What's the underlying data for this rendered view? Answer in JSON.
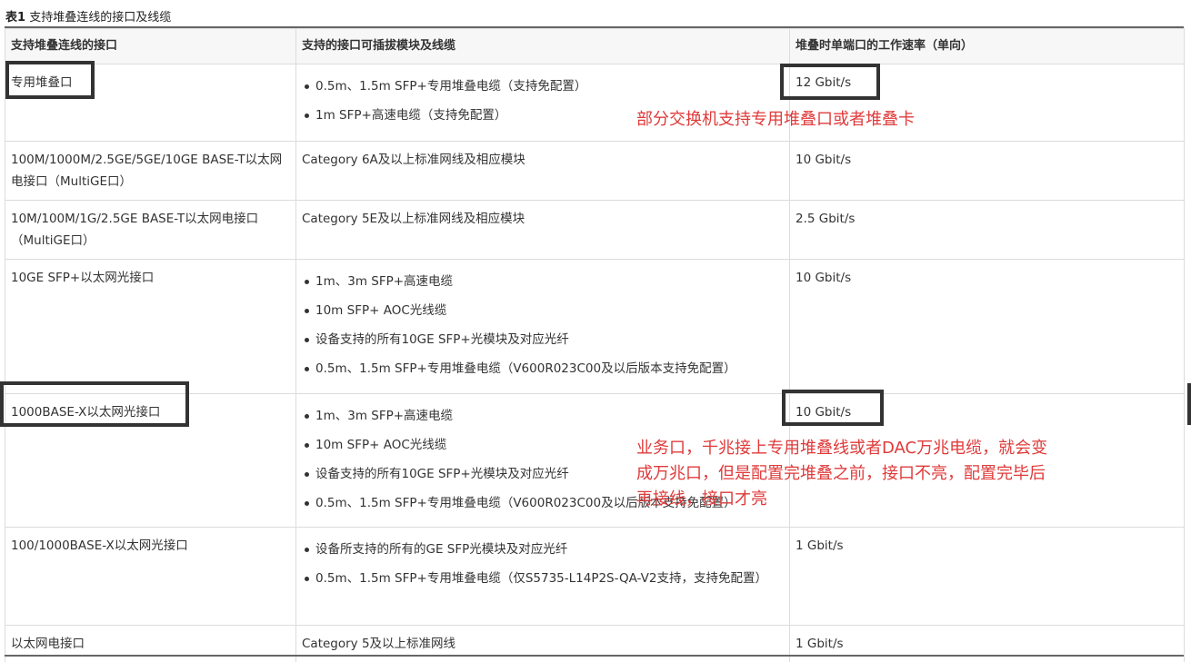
{
  "caption": {
    "label": "表1",
    "text": "支持堆叠连线的接口及线缆"
  },
  "table": {
    "headers": [
      "支持堆叠连线的接口",
      "支持的接口可插拔模块及线缆",
      "堆叠时单端口的工作速率（单向）"
    ],
    "rows": [
      {
        "interface": "专用堆叠口",
        "items": [
          "0.5m、1.5m SFP+专用堆叠电缆（支持免配置）",
          "1m SFP+高速电缆（支持免配置）"
        ],
        "speed": "12 Gbit/s"
      },
      {
        "interface": "100M/1000M/2.5GE/5GE/10GE BASE-T以太网电接口（MultiGE口）",
        "text": "Category 6A及以上标准网线及相应模块",
        "speed": "10 Gbit/s"
      },
      {
        "interface": "10M/100M/1G/2.5GE BASE-T以太网电接口（MultiGE口）",
        "text": "Category 5E及以上标准网线及相应模块",
        "speed": "2.5 Gbit/s"
      },
      {
        "interface": "10GE SFP+以太网光接口",
        "items": [
          "1m、3m SFP+高速电缆",
          "10m SFP+ AOC光线缆",
          "设备支持的所有10GE SFP+光模块及对应光纤",
          "0.5m、1.5m SFP+专用堆叠电缆（V600R023C00及以后版本支持免配置）"
        ],
        "speed": "10 Gbit/s"
      },
      {
        "interface": "1000BASE-X以太网光接口",
        "items": [
          "1m、3m SFP+高速电缆",
          "10m SFP+ AOC光线缆",
          "设备支持的所有10GE SFP+光模块及对应光纤",
          "0.5m、1.5m SFP+专用堆叠电缆（V600R023C00及以后版本支持免配置）"
        ],
        "speed": "10 Gbit/s"
      },
      {
        "interface": "100/1000BASE-X以太网光接口",
        "items": [
          "设备所支持的所有的GE SFP光模块及对应光纤",
          "0.5m、1.5m SFP+专用堆叠电缆（仅S5735-L14P2S-QA-V2支持，支持免配置）"
        ],
        "speed": "1 Gbit/s"
      },
      {
        "interface": "以太网电接口",
        "text": "Category 5及以上标准网线",
        "speed": "1 Gbit/s"
      }
    ]
  },
  "annotations": {
    "note1": "部分交换机支持专用堆叠口或者堆叠卡",
    "note2_line1": "业务口，千兆接上专用堆叠线或者DAC万兆电缆，就会变",
    "note2_line2": "成万兆口，但是配置完堆叠之前，接口不亮，配置完毕后",
    "note2_line3": "再接线，接口才亮"
  },
  "colors": {
    "annotation_text": "#e03a3a",
    "highlight_box": "#333333",
    "header_bg": "#f7f7f7"
  }
}
